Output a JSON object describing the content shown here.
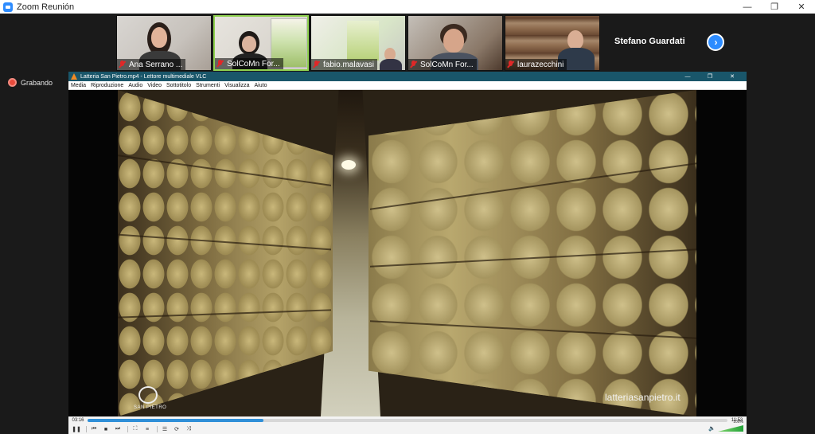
{
  "window": {
    "title": "Zoom Reunión",
    "controls": {
      "minimize": "—",
      "maximize": "❐",
      "close": "✕"
    }
  },
  "participants": [
    {
      "name": "Ana Serrano ...",
      "muted": true
    },
    {
      "name": "SolCoMn For...",
      "muted": true,
      "active": true
    },
    {
      "name": "fabio.malavasi",
      "muted": true
    },
    {
      "name": "SolCoMn For...",
      "muted": true
    },
    {
      "name": "laurazecchini",
      "muted": true
    }
  ],
  "active_speaker": "Stefano Guardati",
  "next_button": "›",
  "recording": {
    "label": "Grabando"
  },
  "vlc": {
    "title": "Latteria San Pietro.mp4 - Lettore multimediale VLC",
    "controls": {
      "minimize": "—",
      "maximize": "❐",
      "close": "✕"
    },
    "menu": [
      "Media",
      "Riproduzione",
      "Audio",
      "Video",
      "Sottotitolo",
      "Strumenti",
      "Visualizza",
      "Aiuto"
    ],
    "video": {
      "watermark": "latteriasanpietro.it",
      "logo_text": "SAN PIETRO"
    },
    "playback": {
      "elapsed": "03:16",
      "duration": "11:53",
      "progress": 0.275
    },
    "buttons": {
      "pause": "❚❚",
      "prev": "⏮",
      "stop": "■",
      "next": "⏭",
      "fullscreen": "⛶",
      "extended": "≡",
      "playlist": "☰",
      "loop": "⟳",
      "random": "⤨"
    },
    "volume": {
      "icon": "🔈",
      "label": "100%",
      "level": 1.0
    }
  }
}
